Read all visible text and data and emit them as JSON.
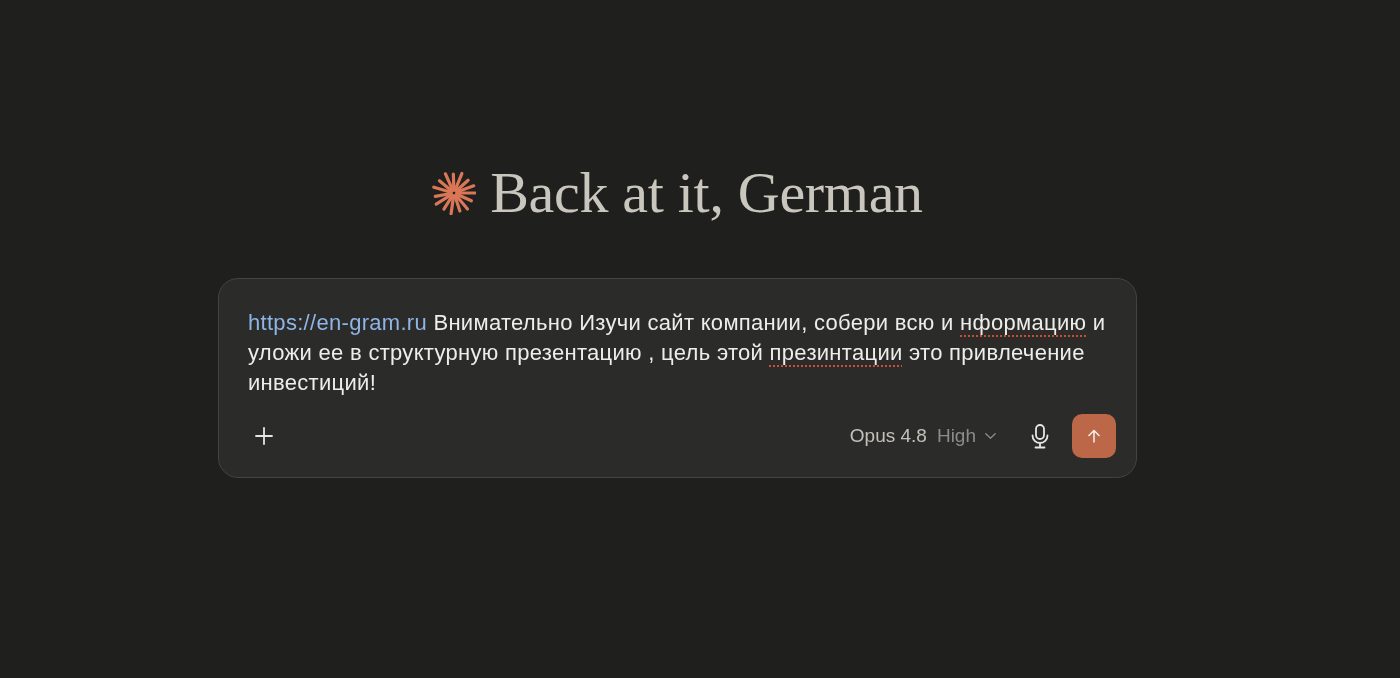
{
  "greeting": {
    "text": "Back at it, German"
  },
  "composer": {
    "message": [
      {
        "kind": "link",
        "text": "https://en-gram.ru"
      },
      {
        "kind": "text",
        "text": " Внимательно Изучи сайт компании, собери всю и "
      },
      {
        "kind": "misspelled",
        "text": "нформацию"
      },
      {
        "kind": "text",
        "text": " и уложи ее в структурную презентацию , цель этой "
      },
      {
        "kind": "misspelled",
        "text": "презинтации"
      },
      {
        "kind": "text",
        "text": " это привлечение инвестиций!"
      }
    ],
    "model_selector": {
      "model": "Opus 4.8",
      "effort": "High"
    }
  }
}
